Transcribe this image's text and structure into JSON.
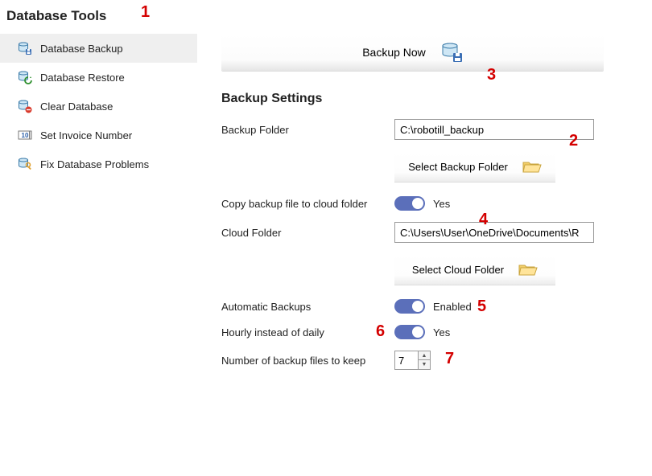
{
  "page_title": "Database Tools",
  "sidebar": {
    "items": [
      {
        "label": "Database Backup"
      },
      {
        "label": "Database Restore"
      },
      {
        "label": "Clear Database"
      },
      {
        "label": "Set Invoice Number"
      },
      {
        "label": "Fix Database Problems"
      }
    ]
  },
  "main": {
    "backup_now_label": "Backup Now",
    "section_heading": "Backup Settings",
    "backup_folder_label": "Backup Folder",
    "backup_folder_value": "C:\\robotill_backup",
    "select_backup_folder_label": "Select Backup Folder",
    "copy_to_cloud_label": "Copy backup file to cloud folder",
    "copy_to_cloud_value": "Yes",
    "cloud_folder_label": "Cloud Folder",
    "cloud_folder_value": "C:\\Users\\User\\OneDrive\\Documents\\R",
    "select_cloud_folder_label": "Select Cloud Folder",
    "automatic_backups_label": "Automatic Backups",
    "automatic_backups_value": "Enabled",
    "hourly_label": "Hourly instead of daily",
    "hourly_value": "Yes",
    "keep_count_label": "Number of backup files to keep",
    "keep_count_value": "7"
  },
  "annotations": {
    "a1": "1",
    "a2": "2",
    "a3": "3",
    "a4": "4",
    "a5": "5",
    "a6": "6",
    "a7": "7"
  }
}
